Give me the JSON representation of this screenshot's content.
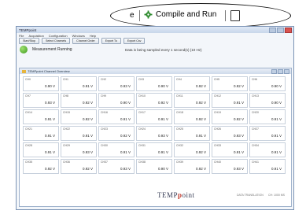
{
  "callout": {
    "prev": "e",
    "run_label": "Compile and Run"
  },
  "window": {
    "title": "TEMPpoint",
    "menu": [
      "File",
      "Acquisition",
      "Configuration",
      "Windows",
      "Help"
    ]
  },
  "toolbar": {
    "buttons": [
      "Start/Stop",
      "Select Channels",
      "Channel Order",
      "Export To",
      "Export Csv"
    ]
  },
  "status": {
    "label": "Measurement Running",
    "message": "Data is being sampled every 1 second(s) (10 Hz)"
  },
  "panel": {
    "title": "TEMPpoint Channel Overview"
  },
  "channels": [
    [
      "CH0",
      "0.90 V"
    ],
    [
      "CH1",
      "0.91 V"
    ],
    [
      "CH2",
      "0.93 V"
    ],
    [
      "CH3",
      "0.90 V"
    ],
    [
      "CH4",
      "0.92 V"
    ],
    [
      "CH5",
      "0.92 V"
    ],
    [
      "CH6",
      "0.90 V"
    ],
    [
      "CH7",
      "0.93 V"
    ],
    [
      "CH8",
      "0.92 V"
    ],
    [
      "CH9",
      "0.90 V"
    ],
    [
      "CH10",
      "0.92 V"
    ],
    [
      "CH11",
      "0.92 V"
    ],
    [
      "CH12",
      "0.91 V"
    ],
    [
      "CH13",
      "0.90 V"
    ],
    [
      "CH14",
      "0.91 V"
    ],
    [
      "CH15",
      "0.92 V"
    ],
    [
      "CH16",
      "0.91 V"
    ],
    [
      "CH17",
      "0.91 V"
    ],
    [
      "CH18",
      "0.92 V"
    ],
    [
      "CH19",
      "0.92 V"
    ],
    [
      "CH20",
      "0.91 V"
    ],
    [
      "CH21",
      "0.91 V"
    ],
    [
      "CH22",
      "0.91 V"
    ],
    [
      "CH23",
      "0.92 V"
    ],
    [
      "CH24",
      "0.93 V"
    ],
    [
      "CH25",
      "0.91 V"
    ],
    [
      "CH26",
      "0.93 V"
    ],
    [
      "CH27",
      "0.91 V"
    ],
    [
      "CH28",
      "0.91 V"
    ],
    [
      "CH29",
      "0.93 V"
    ],
    [
      "CH30",
      "0.91 V"
    ],
    [
      "CH31",
      "0.91 V"
    ],
    [
      "CH32",
      "0.92 V"
    ],
    [
      "CH33",
      "0.91 V"
    ],
    [
      "CH34",
      "0.91 V"
    ],
    [
      "CH35",
      "0.92 V"
    ],
    [
      "CH36",
      "0.92 V"
    ],
    [
      "CH37",
      "0.93 V"
    ],
    [
      "CH38",
      "0.90 V"
    ],
    [
      "CH39",
      "0.92 V"
    ],
    [
      "CH40",
      "0.93 V"
    ],
    [
      "CH41",
      "0.91 V"
    ]
  ],
  "logo": {
    "pre": "TEMP",
    "accent": "p",
    "post": "oint"
  },
  "footer": {
    "left": "DATA TRANSLATION",
    "right": "CH: 1000 MS"
  }
}
